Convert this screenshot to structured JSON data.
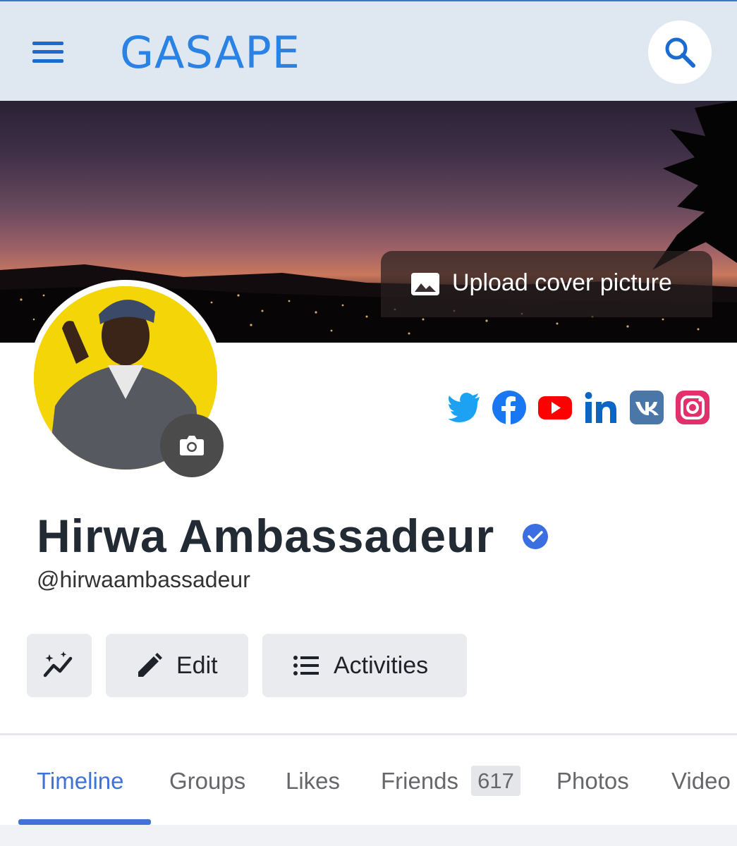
{
  "header": {
    "logo_text": "GASAPE",
    "menu_icon": "hamburger-icon",
    "search_icon": "search-icon",
    "accent_color": "#2a82e4"
  },
  "cover": {
    "upload_label": "Upload cover picture",
    "upload_icon": "image-icon"
  },
  "profile": {
    "avatar_icon": "camera-icon",
    "name": "Hirwa Ambassadeur",
    "verified_icon": "verified-badge-icon",
    "handle": "@hirwaambassadeur"
  },
  "social_links": [
    {
      "icon": "twitter-icon",
      "color": "#1da1f2"
    },
    {
      "icon": "facebook-icon",
      "color": "#1877f2"
    },
    {
      "icon": "youtube-icon",
      "color": "#ff0000"
    },
    {
      "icon": "linkedin-icon",
      "color": "#0a66c2"
    },
    {
      "icon": "vk-icon",
      "color": "#4a76a8"
    },
    {
      "icon": "instagram-icon",
      "color": "#e1306c"
    }
  ],
  "actions": {
    "stats_icon": "sparkle-chart-icon",
    "edit_label": "Edit",
    "edit_icon": "pencil-icon",
    "activities_label": "Activities",
    "activities_icon": "list-icon"
  },
  "tabs": [
    {
      "label": "Timeline",
      "active": true
    },
    {
      "label": "Groups"
    },
    {
      "label": "Likes"
    },
    {
      "label": "Friends",
      "count": "617"
    },
    {
      "label": "Photos"
    },
    {
      "label": "Video"
    }
  ]
}
